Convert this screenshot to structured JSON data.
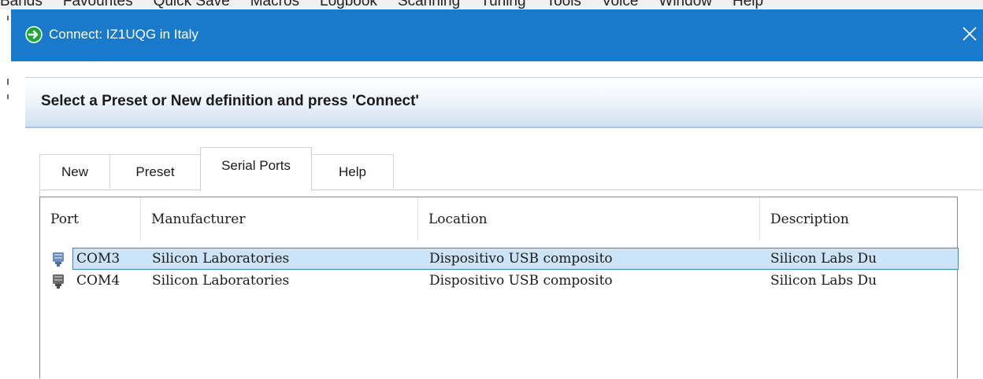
{
  "background_app": {
    "menu_items": [
      "Bands",
      "Favourites",
      "Quick Save",
      "Macros",
      "Logbook",
      "Scanning",
      "Tuning",
      "Tools",
      "Voice",
      "Window",
      "Help"
    ]
  },
  "dialog": {
    "title": "Connect: IZ1UQG in Italy",
    "app_icon": "green-arrow-circle-icon",
    "close_icon": "close-icon",
    "header": "Select a Preset or New definition and press 'Connect'",
    "tabs": [
      {
        "label": "New",
        "active": false
      },
      {
        "label": "Preset",
        "active": false
      },
      {
        "label": "Serial Ports",
        "active": true
      },
      {
        "label": "Help",
        "active": false
      }
    ],
    "ports_table": {
      "columns": [
        "Port",
        "Manufacturer",
        "Location",
        "Description"
      ],
      "rows": [
        {
          "port": "COM3",
          "manufacturer": "Silicon Laboratories",
          "location": "Dispositivo USB composito",
          "description": "Silicon Labs Du",
          "selected": true,
          "icon": "serial-port-icon"
        },
        {
          "port": "COM4",
          "manufacturer": "Silicon Laboratories",
          "location": "Dispositivo USB composito",
          "description": "Silicon Labs Du",
          "selected": false,
          "icon": "serial-port-icon"
        }
      ]
    }
  },
  "colors": {
    "titlebar": "#1979ca",
    "selection": "#cce4f7",
    "selection_border": "#3d86c9",
    "app_icon": "#1fa33a"
  }
}
